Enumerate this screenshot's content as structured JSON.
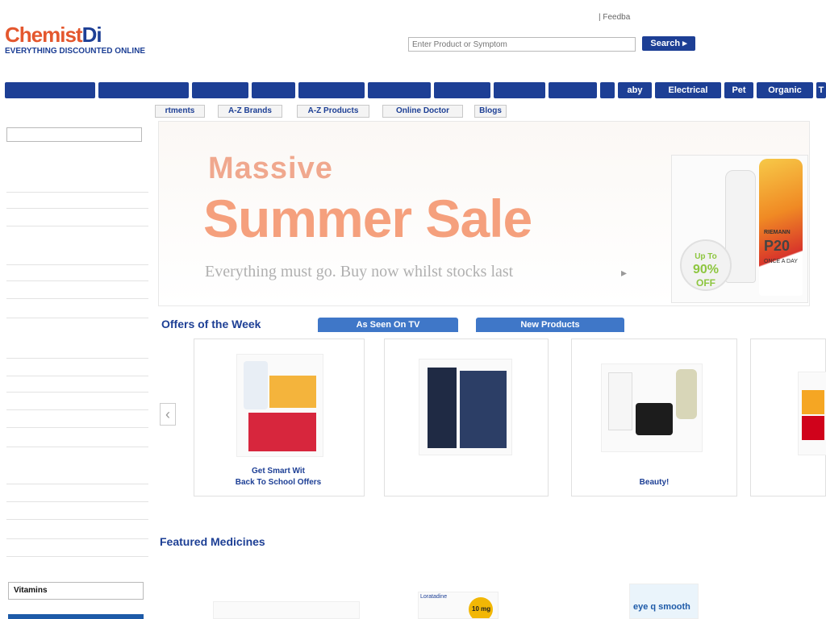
{
  "header": {
    "logo_part1": "Chemist",
    "logo_part2": "Di",
    "logo_tagline": "EVERYTHING DISCOUNTED ONLINE",
    "search_placeholder": "Enter Product or Symptom",
    "search_button": "Search ▸",
    "feedback": "|  Feedba"
  },
  "nav": {
    "items": [
      "",
      "",
      "",
      "",
      "",
      "",
      "",
      "",
      "",
      "",
      "aby",
      "Electrical",
      "Pet",
      "Organic",
      "T"
    ]
  },
  "subnav": {
    "items": [
      "rtments",
      "A-Z Brands",
      "A-Z Products",
      "Online Doctor",
      "Blogs"
    ]
  },
  "sidebar": {
    "vitamins_field": "Vitamins"
  },
  "hero": {
    "pre_title": "Massive",
    "title": "Summer Sale",
    "subtitle": "Everything must go. Buy now whilst stocks last",
    "subtitle_arrow": "▸",
    "badge_line1": "Up To",
    "badge_line2": "90%",
    "badge_line3": "OFF",
    "product_brand": "RIEMANN",
    "product_spf": "P20",
    "product_label": "ONCE A DAY"
  },
  "offers": {
    "heading": "Offers of the Week",
    "tabs": [
      "As Seen On TV",
      "New Products"
    ],
    "prev_arrow": "‹",
    "cards": [
      {
        "caption1": "Get Smart Wit",
        "caption2": "Back To School Offers"
      },
      {
        "caption1": "",
        "caption2": ""
      },
      {
        "caption1": "",
        "caption2": "Beauty!"
      },
      {
        "caption1": "",
        "caption2": ""
      }
    ]
  },
  "featured": {
    "heading": "Featured Medicines",
    "item_dose": "10 mg",
    "item_name": "Loratadine",
    "item_brand": "eye q smooth"
  }
}
